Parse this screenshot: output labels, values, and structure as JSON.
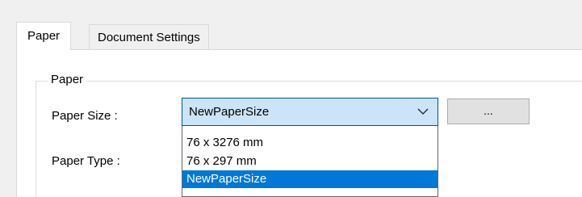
{
  "tabs": [
    {
      "label": "Paper",
      "active": true
    },
    {
      "label": "Document Settings",
      "active": false
    }
  ],
  "group": {
    "title": "Paper"
  },
  "fields": {
    "paper_size_label": "Paper Size :",
    "paper_type_label": "Paper Type :",
    "paper_size_value": "NewPaperSize",
    "browse_label": "..."
  },
  "dropdown": {
    "options": [
      "76 x 3276 mm",
      "76 x 297 mm",
      "NewPaperSize"
    ],
    "selected_index": 2
  },
  "icons": {
    "combo_arrow": "chevron-down-icon"
  },
  "colors": {
    "selection": "#0078d7",
    "combo_focus_bg": "#cce4f7",
    "combo_focus_border": "#005499"
  }
}
